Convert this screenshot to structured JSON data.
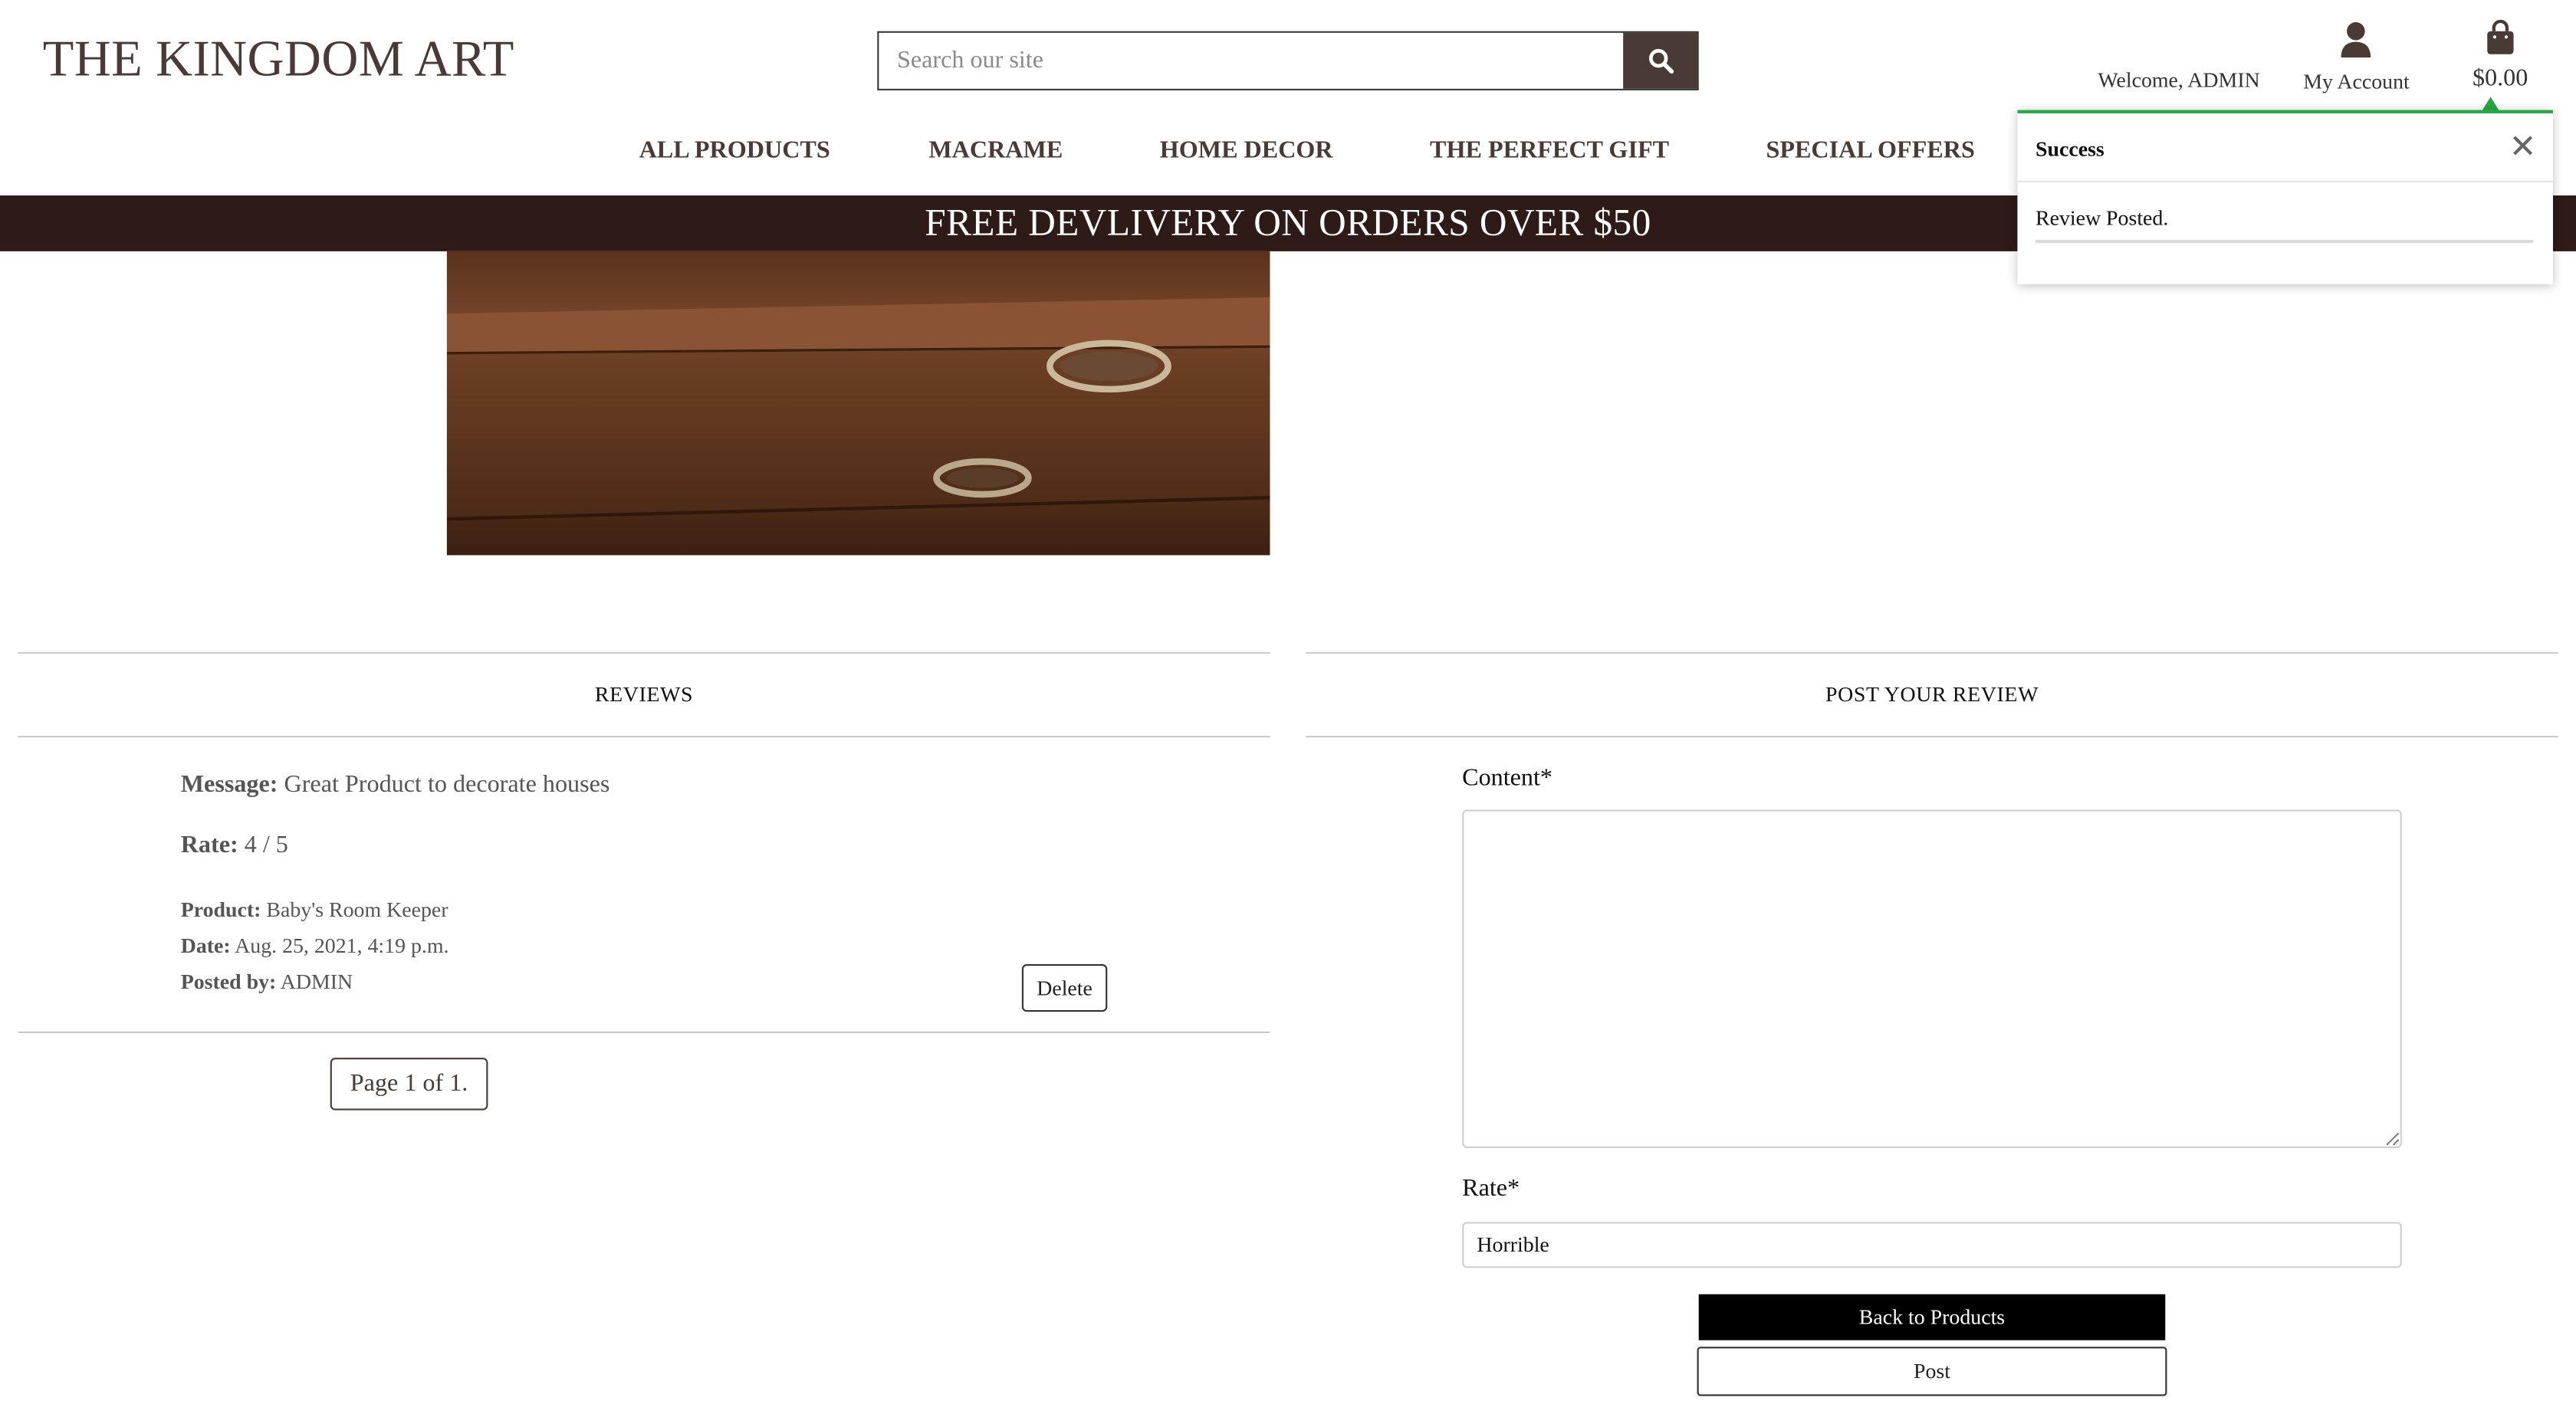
{
  "brand": {
    "title": "THE KINGDOM ART"
  },
  "search": {
    "placeholder": "Search our site",
    "value": ""
  },
  "account": {
    "welcome": "Welcome, ADMIN",
    "my_account_label": "My Account",
    "cart_total": "$0.00"
  },
  "nav": {
    "items": [
      {
        "label": "ALL PRODUCTS"
      },
      {
        "label": "MACRAME"
      },
      {
        "label": "HOME DECOR"
      },
      {
        "label": "THE PERFECT GIFT"
      },
      {
        "label": "SPECIAL OFFERS"
      }
    ]
  },
  "banner": {
    "text": "FREE DEVLIVERY ON ORDERS OVER $50"
  },
  "reviews": {
    "title": "REVIEWS",
    "items": [
      {
        "message_label": "Message:",
        "message": "Great Product to decorate houses",
        "rate_label": "Rate:",
        "rate": "4 / 5",
        "product_label": "Product:",
        "product": "Baby's Room Keeper",
        "date_label": "Date:",
        "date": "Aug. 25, 2021, 4:19 p.m.",
        "posted_by_label": "Posted by:",
        "posted_by": "ADMIN",
        "delete_label": "Delete"
      }
    ],
    "pagination": "Page 1 of 1."
  },
  "post_review": {
    "title": "POST YOUR REVIEW",
    "content_label": "Content*",
    "content_value": "",
    "rate_label": "Rate*",
    "rate_value": "Horrible",
    "back_label": "Back to Products",
    "post_label": "Post"
  },
  "toast": {
    "title": "Success",
    "message": "Review Posted.",
    "close_icon": "close-icon",
    "accent_color": "#28a745"
  },
  "colors": {
    "brand": "#4a3a36",
    "banner_bg": "#2e1b18",
    "success": "#28a745"
  }
}
